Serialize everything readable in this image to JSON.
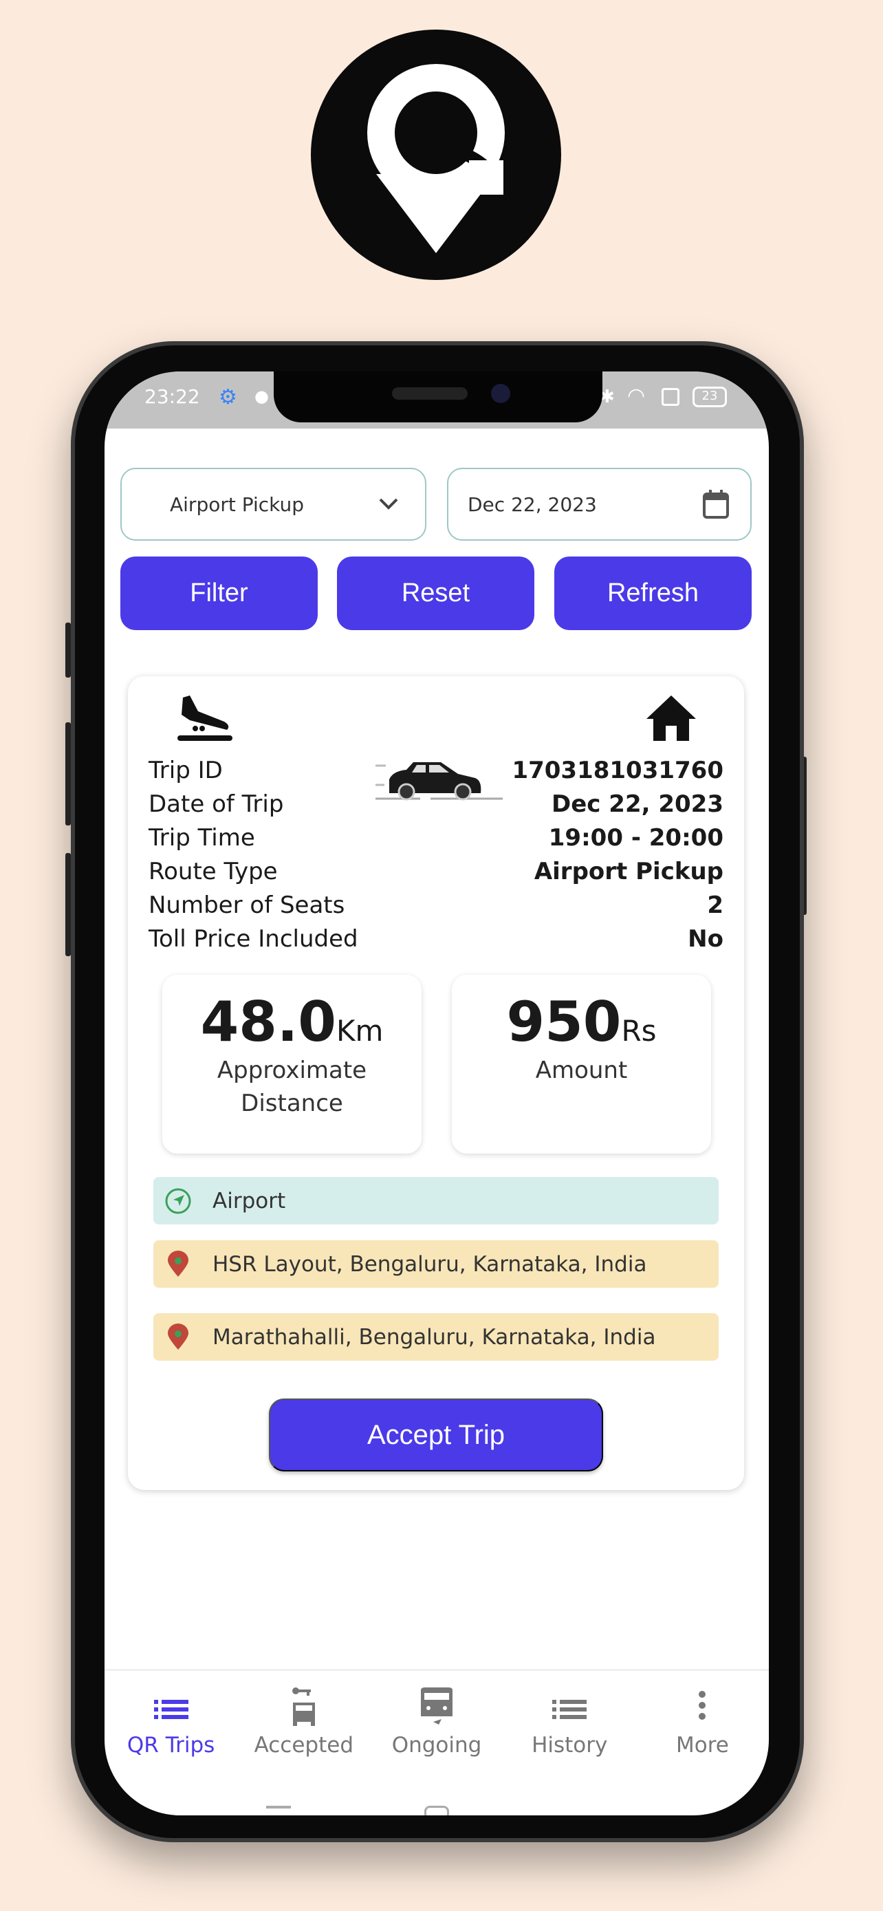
{
  "status_bar": {
    "time": "23:22",
    "battery": "23"
  },
  "filters": {
    "route_type": "Airport Pickup",
    "date": "Dec 22, 2023"
  },
  "buttons": {
    "filter": "Filter",
    "reset": "Reset",
    "refresh": "Refresh"
  },
  "trip": {
    "rows": [
      {
        "label": "Trip ID",
        "value": "1703181031760"
      },
      {
        "label": "Date of Trip",
        "value": "Dec 22, 2023"
      },
      {
        "label": "Trip Time",
        "value": "19:00 - 20:00"
      },
      {
        "label": "Route Type",
        "value": "Airport Pickup"
      },
      {
        "label": "Number of Seats",
        "value": "2"
      },
      {
        "label": "Toll Price Included",
        "value": "No"
      }
    ],
    "distance": {
      "value": "48.0",
      "unit": "Km",
      "label": "Approximate Distance"
    },
    "amount": {
      "value": "950",
      "unit": "Rs",
      "label": "Amount"
    },
    "locations": [
      {
        "text": "Airport",
        "icon": "navigation-icon",
        "color": "#d6eeeb"
      },
      {
        "text": "HSR Layout, Bengaluru, Karnataka, India",
        "icon": "map-pin-icon",
        "color": "#f8e6b8"
      },
      {
        "text": "Marathahalli, Bengaluru, Karnataka, India",
        "icon": "map-pin-icon",
        "color": "#f8e6b8"
      }
    ],
    "accept_label": "Accept Trip"
  },
  "nav": [
    {
      "label": "QR Trips",
      "icon": "list-icon",
      "active": true
    },
    {
      "label": "Accepted",
      "icon": "car-key-icon"
    },
    {
      "label": "Ongoing",
      "icon": "car-icon"
    },
    {
      "label": "History",
      "icon": "list-icon"
    },
    {
      "label": "More",
      "icon": "more-vertical-icon"
    }
  ],
  "colors": {
    "accent": "#4b3ae8",
    "background": "#fcebdd"
  }
}
